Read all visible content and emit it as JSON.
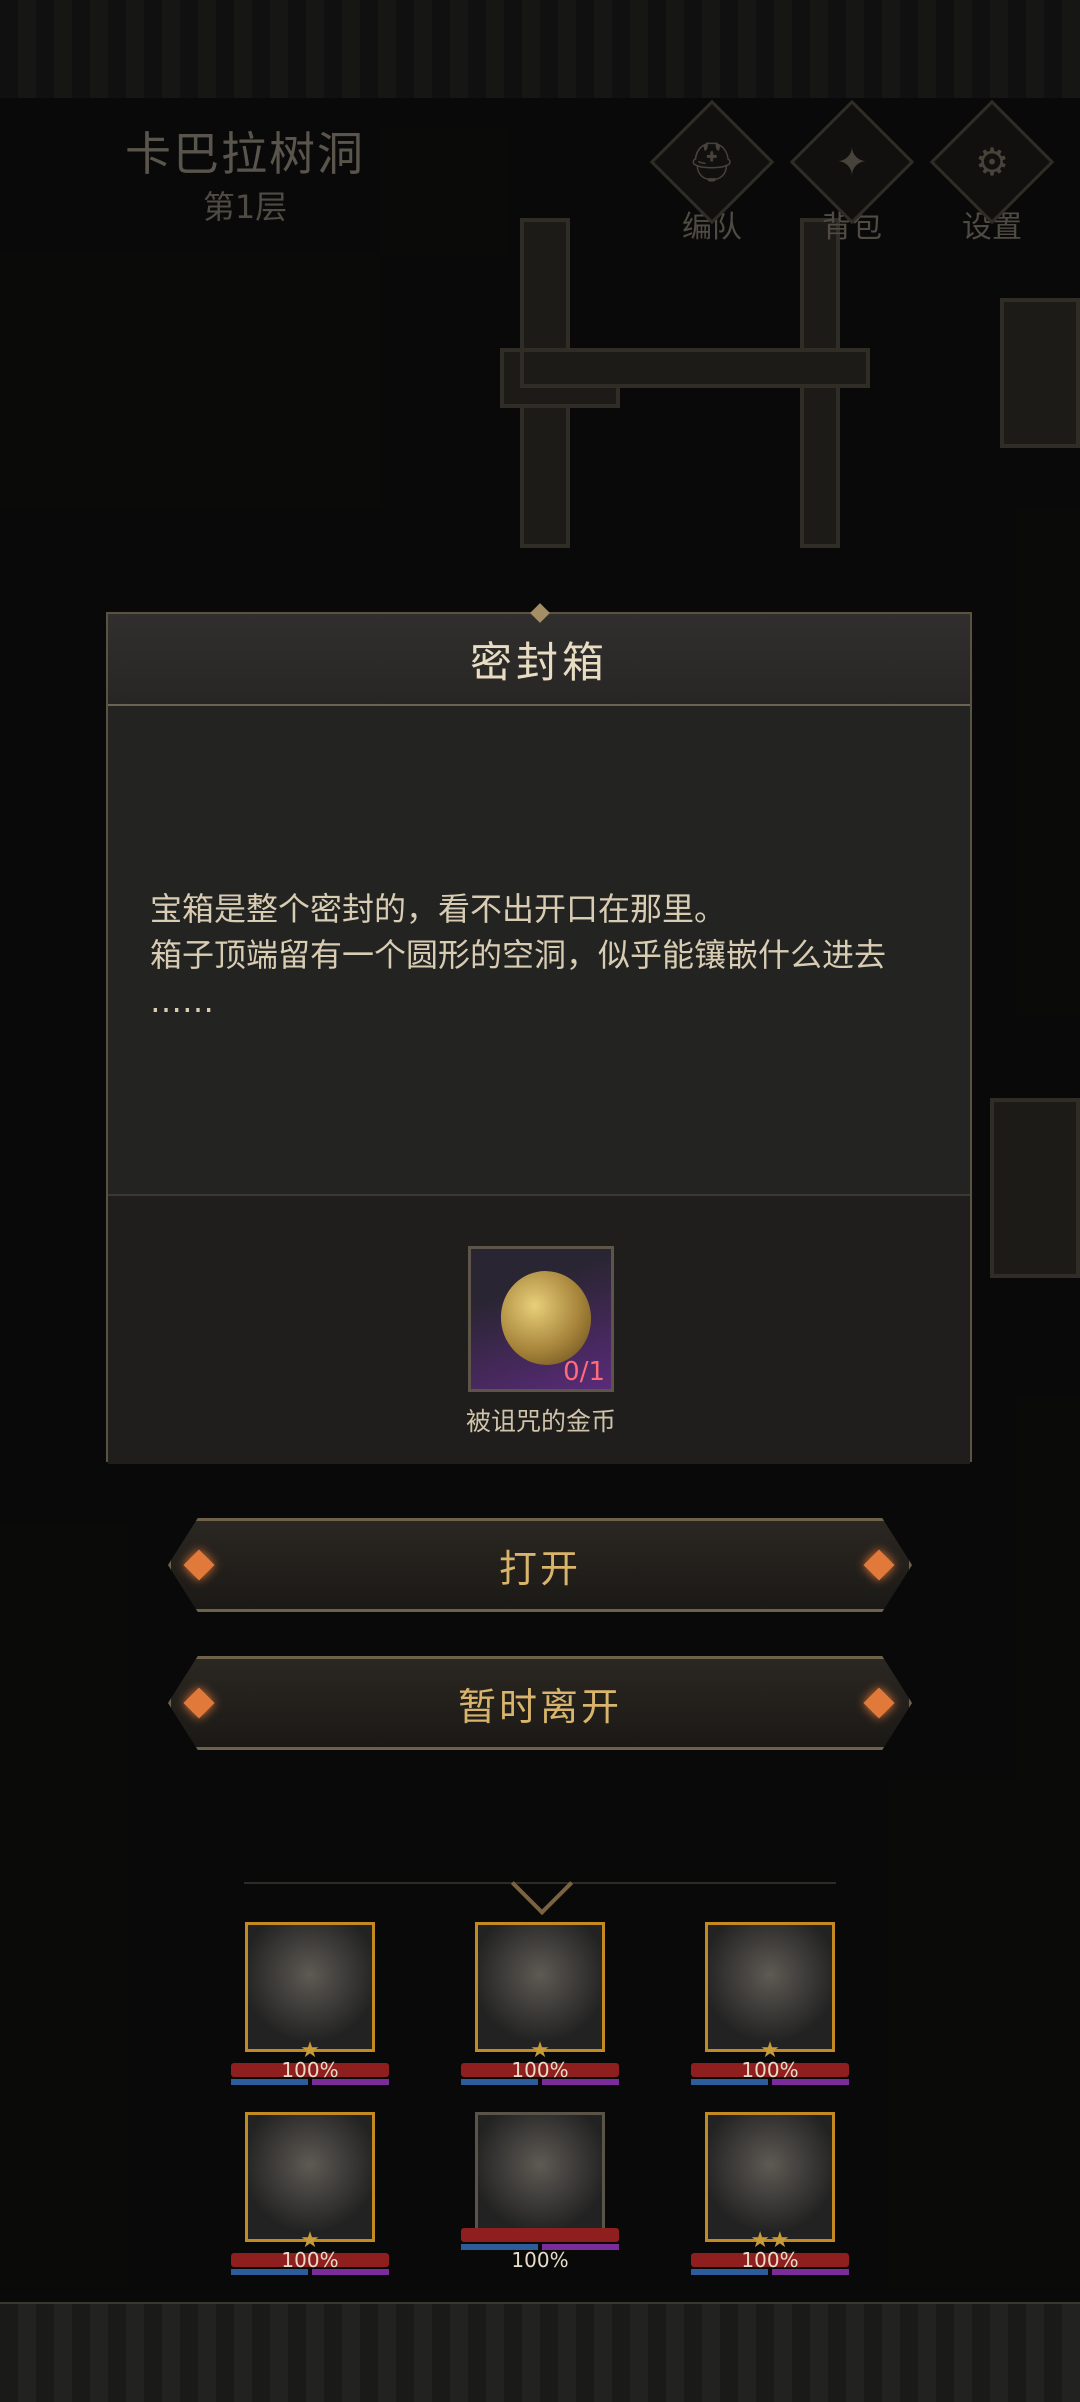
{
  "location": {
    "name": "卡巴拉树洞",
    "floor": "第1层"
  },
  "top_menu": [
    {
      "label": "编队",
      "icon": "helmet-icon"
    },
    {
      "label": "背包",
      "icon": "bag-icon"
    },
    {
      "label": "设置",
      "icon": "gear-icon"
    }
  ],
  "dialog": {
    "title": "密封箱",
    "lines": [
      "宝箱是整个密封的，看不出开口在那里。",
      "箱子顶端留有一个圆形的空洞，似乎能镶嵌什么进去",
      "……"
    ],
    "item": {
      "name": "被诅咒的金币",
      "count": "0/1"
    }
  },
  "actions": {
    "open_label": "打开",
    "leave_label": "暂时离开"
  },
  "party": [
    {
      "hp": "100%",
      "stars": "★"
    },
    {
      "hp": "100%",
      "stars": "★"
    },
    {
      "hp": "100%",
      "stars": "★"
    },
    {
      "hp": "100%",
      "stars": "★"
    },
    {
      "hp": "100%",
      "stars": ""
    },
    {
      "hp": "100%",
      "stars": "★★"
    }
  ],
  "colors": {
    "accent": "#d9b56c",
    "portrait_frame": "#c48a22",
    "hp_bar": "#8f1e1e",
    "item_count": "#ff6b7a"
  }
}
